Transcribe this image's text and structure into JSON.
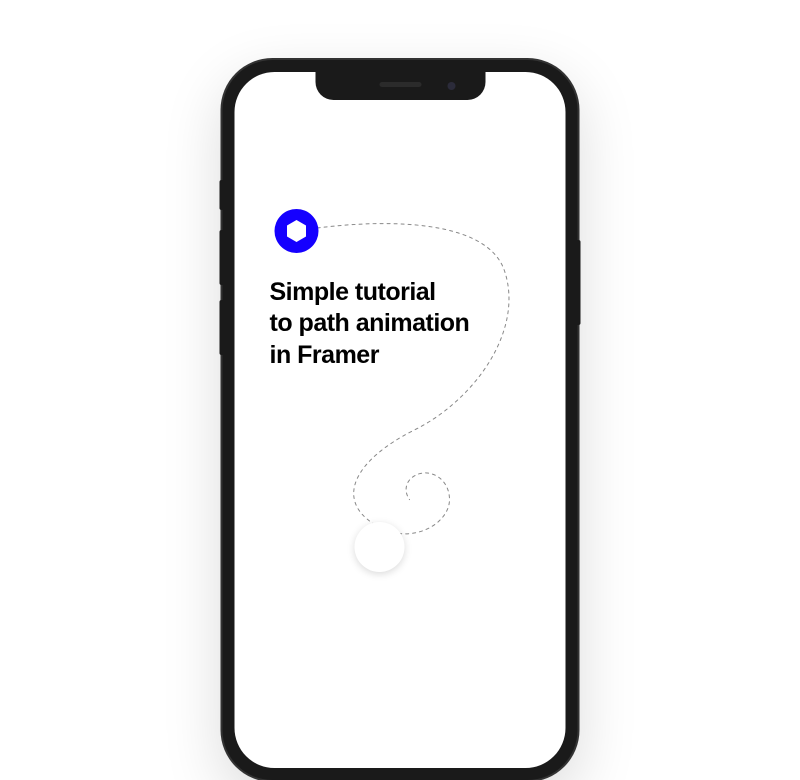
{
  "heading": {
    "line1": "Simple tutorial",
    "line2": "to path animation",
    "line3": "in Framer"
  },
  "colors": {
    "accent": "#1500ff",
    "text": "#000000",
    "pathStroke": "#888888"
  }
}
